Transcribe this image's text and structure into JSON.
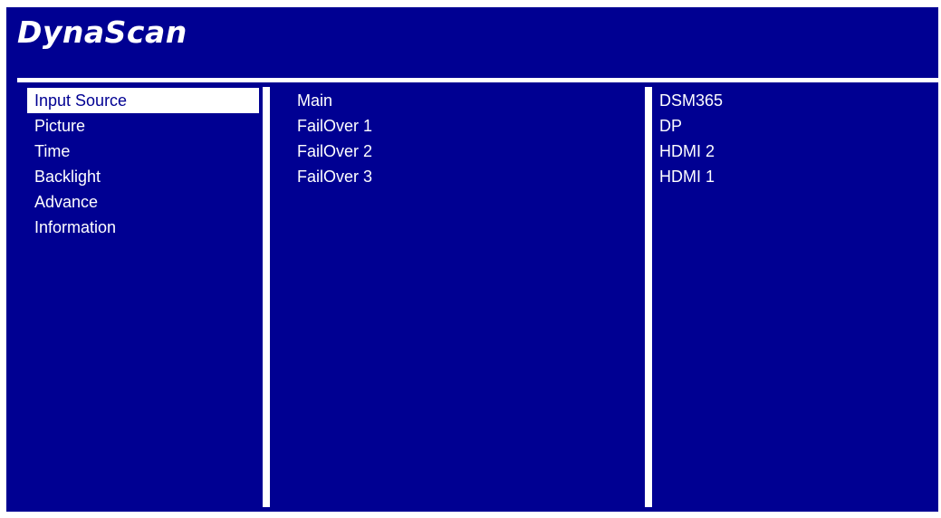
{
  "header": {
    "logo_text": "DynaScan"
  },
  "menu": {
    "items": [
      {
        "label": "Input Source",
        "selected": true
      },
      {
        "label": "Picture",
        "selected": false
      },
      {
        "label": "Time",
        "selected": false
      },
      {
        "label": "Backlight",
        "selected": false
      },
      {
        "label": "Advance",
        "selected": false
      },
      {
        "label": "Information",
        "selected": false
      }
    ]
  },
  "input_source": {
    "slots": [
      "Main",
      "FailOver 1",
      "FailOver 2",
      "FailOver 3"
    ],
    "values": [
      "DSM365",
      "DP",
      "HDMI 2",
      "HDMI 1"
    ]
  },
  "colors": {
    "background": "#000092",
    "text": "#ffffff",
    "selection_bg": "#ffffff",
    "selection_text": "#000092"
  }
}
